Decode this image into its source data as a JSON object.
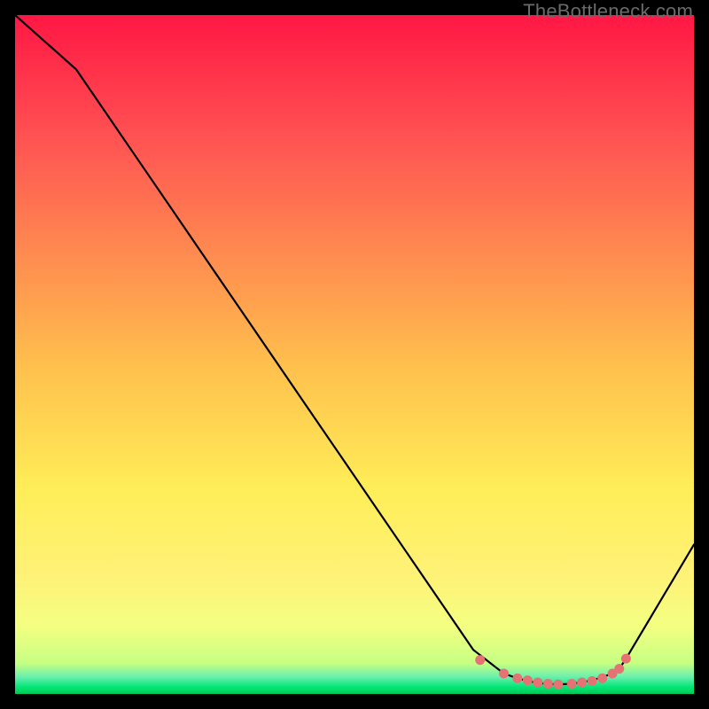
{
  "attribution": "TheBottleneck.com",
  "chart_data": {
    "type": "line",
    "title": "",
    "xlabel": "",
    "ylabel": "",
    "xlim": [
      0,
      100
    ],
    "ylim": [
      0,
      100
    ],
    "series": [
      {
        "name": "curve",
        "x": [
          0,
          9,
          67.5,
          72,
          74,
          76,
          78,
          80,
          82,
          84,
          86,
          88,
          89,
          90,
          100
        ],
        "y": [
          100,
          92,
          6.5,
          3.0,
          2.3,
          1.8,
          1.5,
          1.4,
          1.5,
          1.8,
          2.3,
          3.0,
          3.7,
          5.2,
          22
        ]
      }
    ],
    "markers": {
      "name": "highlight-points",
      "color": "#e57373",
      "x": [
        68.5,
        72,
        74,
        75.5,
        77,
        78.5,
        80,
        82,
        83.5,
        85,
        86.5,
        88,
        89,
        90
      ],
      "y": [
        5.0,
        3.0,
        2.3,
        2.0,
        1.7,
        1.5,
        1.4,
        1.5,
        1.7,
        1.9,
        2.3,
        3.0,
        3.7,
        5.2
      ]
    },
    "gradient_stops": [
      {
        "offset": 0.0,
        "color": "#ff1744"
      },
      {
        "offset": 0.18,
        "color": "#ff5252"
      },
      {
        "offset": 0.35,
        "color": "#ff8a50"
      },
      {
        "offset": 0.52,
        "color": "#ffc14d"
      },
      {
        "offset": 0.7,
        "color": "#ffee58"
      },
      {
        "offset": 0.82,
        "color": "#fff176"
      },
      {
        "offset": 0.9,
        "color": "#f4ff81"
      },
      {
        "offset": 0.955,
        "color": "#c6ff82"
      },
      {
        "offset": 0.975,
        "color": "#69f0ae"
      },
      {
        "offset": 0.99,
        "color": "#00e676"
      },
      {
        "offset": 1.0,
        "color": "#00c853"
      }
    ]
  }
}
